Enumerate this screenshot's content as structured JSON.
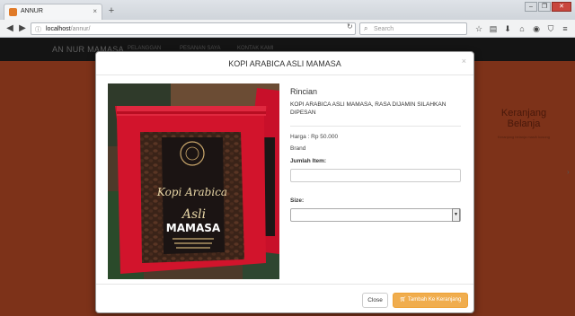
{
  "browser": {
    "tab_title": "ANNUR",
    "tab_close": "×",
    "new_tab": "+",
    "url_host": "localhost",
    "url_path": "/annur/",
    "search_placeholder": "Search",
    "window_controls": [
      "–",
      "❐",
      "✕"
    ],
    "toolbar_icons": [
      "star-icon",
      "clipboard-icon",
      "download-icon",
      "home-icon",
      "pocket-icon",
      "shield-icon",
      "menu-icon"
    ]
  },
  "site": {
    "brand": "AN NUR MAMASA",
    "nav_links": [
      "PELANGGAN",
      "PESANAN SAYA",
      "KONTAK KAMI"
    ],
    "cart_title": "Keranjang Belanja",
    "cart_subtitle": "Keranjang belanja masih kosong"
  },
  "modal": {
    "title": "KOPI ARABICA ASLI MAMASA",
    "close_symbol": "×",
    "details_heading": "Rincian",
    "description": "KOPI ARABICA ASLI MAMASA, RASA DIJAMIN SILAHKAN DIPESAN",
    "price": "Harga : Rp 50.000",
    "brand": "Brand",
    "quantity_label": "Jumlah Item:",
    "quantity_value": "",
    "size_label": "Size:",
    "size_value": "",
    "close_button": "Close",
    "add_button": "Tambah Ke Keranjang",
    "product_label": {
      "line1": "Kopi Arabica",
      "line2": "Asli",
      "line3": "MAMASA"
    }
  },
  "colors": {
    "site_background": "#b84a25",
    "nav_background": "#1e1e1e",
    "button_warning": "#f0ad4e",
    "bag_red": "#d2142c"
  }
}
